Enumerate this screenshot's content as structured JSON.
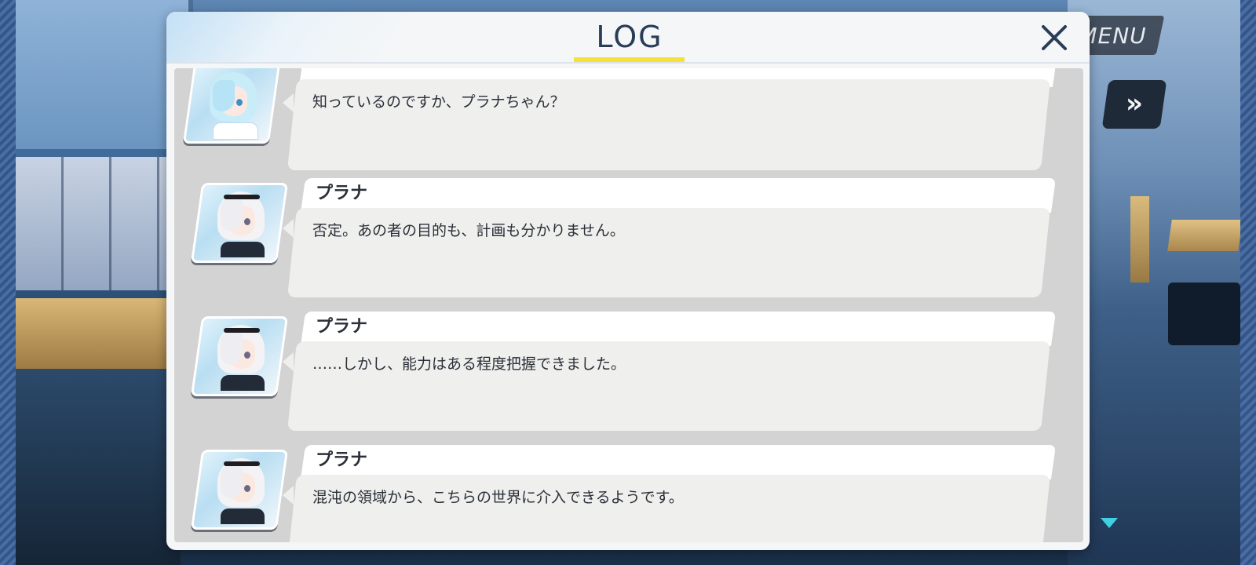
{
  "hud": {
    "menu_label": "MENU",
    "skip_icon": "fast-forward-icon"
  },
  "dialog": {
    "title": "LOG",
    "close_icon": "close-icon",
    "accent_color": "#f5e13a",
    "title_color": "#2a3d57"
  },
  "log": {
    "entries": [
      {
        "speaker": "",
        "avatar": "arona-portrait",
        "message": "知っているのですか、プラナちゃん？"
      },
      {
        "speaker": "プラナ",
        "avatar": "plana-portrait",
        "message": "否定。あの者の目的も、計画も分かりません。"
      },
      {
        "speaker": "プラナ",
        "avatar": "plana-portrait",
        "message": "……しかし、能力はある程度把握できました。"
      },
      {
        "speaker": "プラナ",
        "avatar": "plana-portrait",
        "message": "混沌の領域から、こちらの世界に介入できるようです。"
      }
    ]
  },
  "indicators": {
    "next_indicator_color": "#3fd0e3"
  }
}
